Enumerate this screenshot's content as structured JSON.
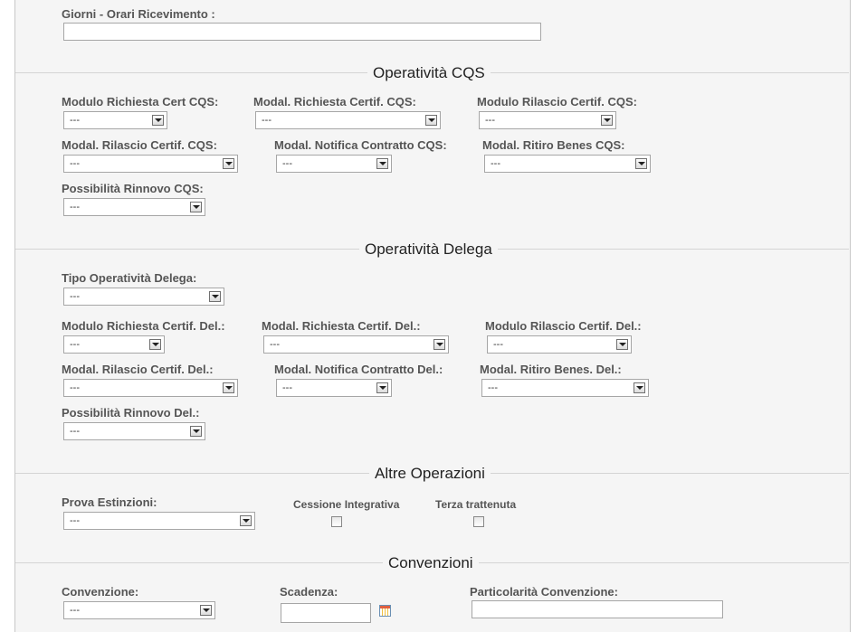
{
  "top": {
    "giorni_label": "Giorni - Orari Ricevimento :",
    "giorni_value": ""
  },
  "sections": {
    "cqs": "Operatività CQS",
    "delega": "Operatività Delega",
    "altre": "Altre Operazioni",
    "convenzioni": "Convenzioni"
  },
  "cqs": {
    "f1_label": "Modulo Richiesta Cert CQS:",
    "f1_value": "---",
    "f2_label": "Modal. Richiesta Certif. CQS:",
    "f2_value": "---",
    "f3_label": "Modulo Rilascio Certif. CQS:",
    "f3_value": "---",
    "f4_label": "Modal. Rilascio Certif. CQS:",
    "f4_value": "---",
    "f5_label": "Modal. Notifica Contratto CQS:",
    "f5_value": "---",
    "f6_label": "Modal. Ritiro Benes CQS:",
    "f6_value": "---",
    "f7_label": "Possibilità Rinnovo CQS:",
    "f7_value": "---"
  },
  "delega": {
    "tipo_label": "Tipo Operatività Delega:",
    "tipo_value": "---",
    "f1_label": "Modulo Richiesta Certif. Del.:",
    "f1_value": "---",
    "f2_label": "Modal. Richiesta Certif. Del.:",
    "f2_value": "---",
    "f3_label": "Modulo Rilascio Certif. Del.:",
    "f3_value": "---",
    "f4_label": "Modal. Rilascio Certif. Del.:",
    "f4_value": "---",
    "f5_label": "Modal. Notifica Contratto Del.:",
    "f5_value": "---",
    "f6_label": "Modal. Ritiro Benes. Del.:",
    "f6_value": "---",
    "f7_label": "Possibilità Rinnovo Del.:",
    "f7_value": "---"
  },
  "altre": {
    "prova_label": "Prova Estinzioni:",
    "prova_value": "---",
    "cessione_label": "Cessione Integrativa",
    "cessione_checked": false,
    "terza_label": "Terza trattenuta",
    "terza_checked": false
  },
  "convenzioni": {
    "conv_label": "Convenzione:",
    "conv_value": "---",
    "scadenza_label": "Scadenza:",
    "scadenza_value": "",
    "partic_label": "Particolarità Convenzione:",
    "partic_value": ""
  },
  "icons": {
    "calendar": "calendar-icon",
    "dropdown": "chevron-down-icon"
  }
}
